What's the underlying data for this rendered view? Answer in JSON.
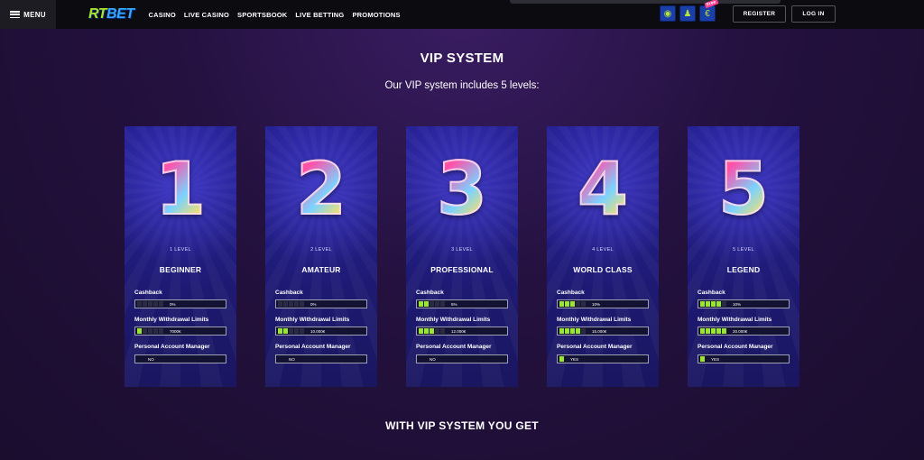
{
  "topbar": {
    "menu_label": "MENU",
    "logo_rt": "RT",
    "logo_bet": "BET",
    "nav": [
      "CASINO",
      "LIVE CASINO",
      "SPORTSBOOK",
      "LIVE BETTING",
      "PROMOTIONS"
    ],
    "icons": [
      "map-pin-icon",
      "chess-icon",
      "coin-icon"
    ],
    "free_badge": "Free",
    "register_label": "REGISTER",
    "login_label": "LOG IN"
  },
  "heading": {
    "title": "VIP SYSTEM",
    "subtitle": "Our VIP system includes 5 levels:"
  },
  "labels": {
    "cashback": "Cashback",
    "withdrawal": "Monthly Withdrawal Limits",
    "manager": "Personal Account Manager"
  },
  "levels": [
    {
      "digit": "1",
      "level_label": "1 LEVEL",
      "name": "BEGINNER",
      "cashback": "0%",
      "cashback_segments": 0,
      "withdrawal": "7000€",
      "withdrawal_segments": 1,
      "manager": "NO",
      "manager_segments": 0
    },
    {
      "digit": "2",
      "level_label": "2 LEVEL",
      "name": "AMATEUR",
      "cashback": "0%",
      "cashback_segments": 0,
      "withdrawal": "10.000€",
      "withdrawal_segments": 2,
      "manager": "NO",
      "manager_segments": 0
    },
    {
      "digit": "3",
      "level_label": "3 LEVEL",
      "name": "PROFESSIONAL",
      "cashback": "5%",
      "cashback_segments": 2,
      "withdrawal": "12.000€",
      "withdrawal_segments": 3,
      "manager": "NO",
      "manager_segments": 0
    },
    {
      "digit": "4",
      "level_label": "4 LEVEL",
      "name": "WORLD CLASS",
      "cashback": "10%",
      "cashback_segments": 3,
      "withdrawal": "15.000€",
      "withdrawal_segments": 4,
      "manager": "YES",
      "manager_segments": 1
    },
    {
      "digit": "5",
      "level_label": "5 LEVEL",
      "name": "LEGEND",
      "cashback": "10%",
      "cashback_segments": 4,
      "withdrawal": "20.000€",
      "withdrawal_segments": 5,
      "manager": "YES",
      "manager_segments": 1
    }
  ],
  "bottom_title": "WITH VIP SYSTEM YOU GET",
  "colors": {
    "accent_green": "#9be635",
    "card_blue": "#262295",
    "background": "#24113f",
    "topbar": "#0b0b10"
  }
}
